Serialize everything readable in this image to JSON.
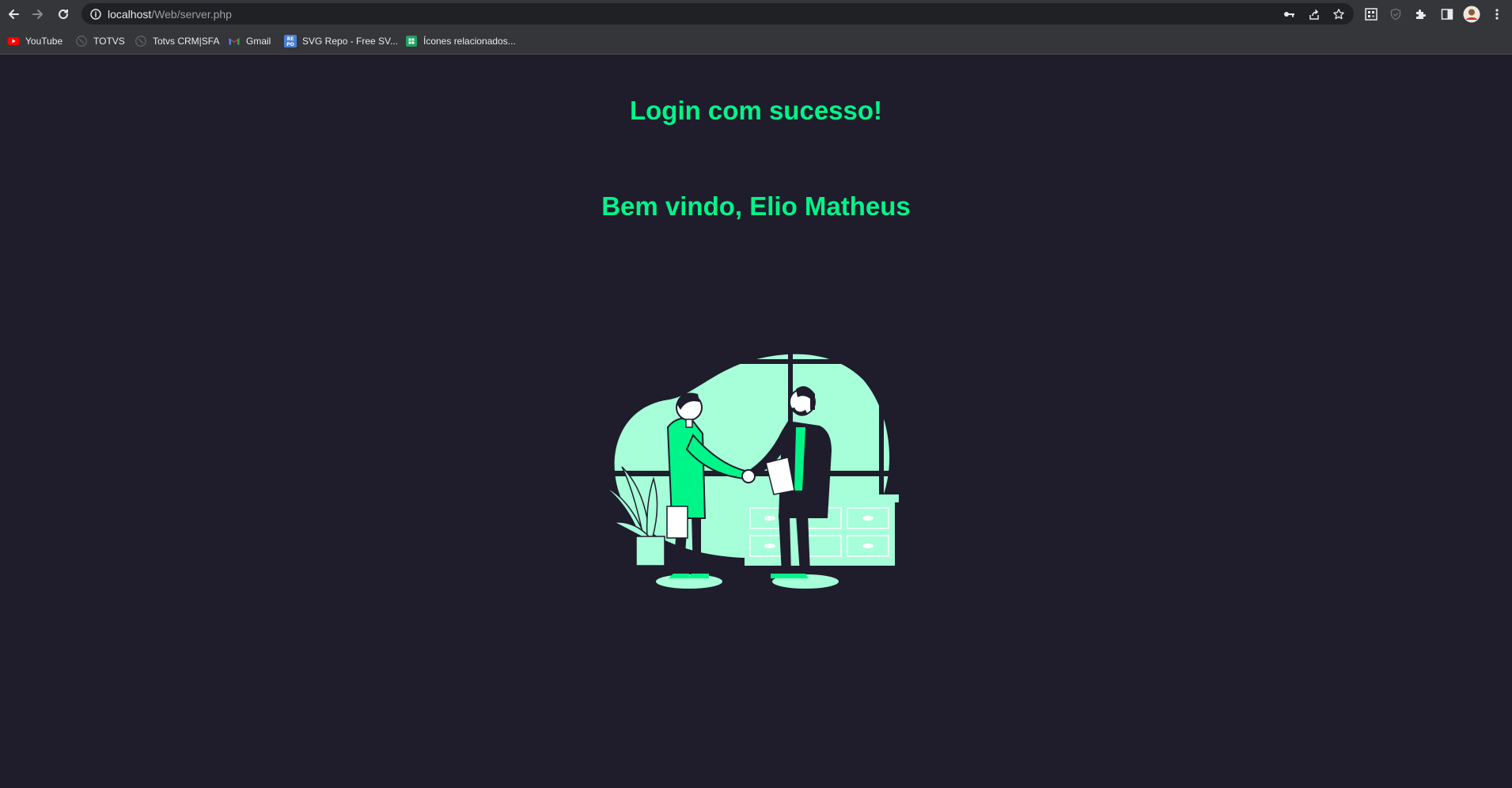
{
  "browser": {
    "url_host": "localhost",
    "url_path": "/Web/server.php"
  },
  "bookmarks": [
    {
      "label": "YouTube"
    },
    {
      "label": "TOTVS"
    },
    {
      "label": "Totvs CRM|SFA"
    },
    {
      "label": "Gmail"
    },
    {
      "label": "SVG Repo - Free SV..."
    },
    {
      "label": "Ícones relacionados..."
    }
  ],
  "main": {
    "title": "Login com sucesso!",
    "welcome": "Bem vindo, Elio Matheus"
  },
  "colors": {
    "accent": "#00f589",
    "background": "#1f1c2c",
    "mint": "#a6ffd9"
  }
}
